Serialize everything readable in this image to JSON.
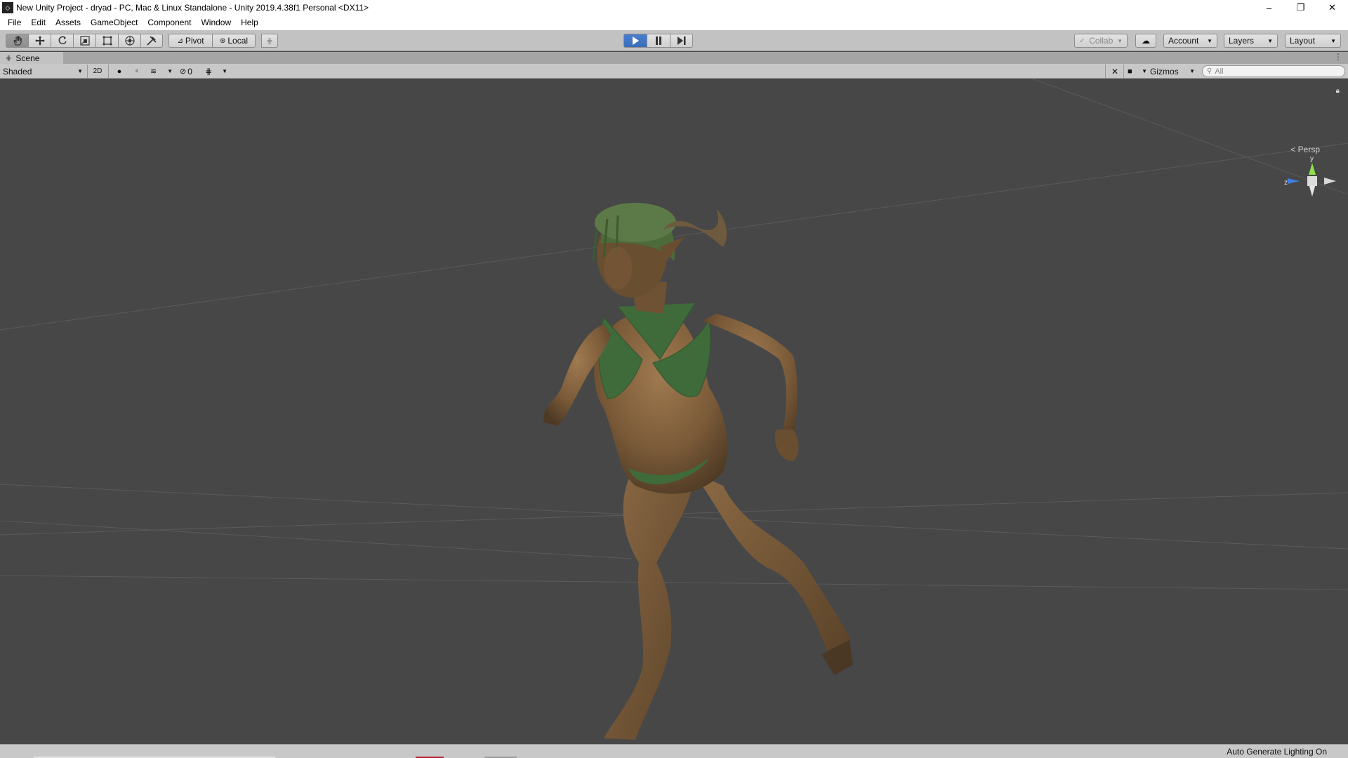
{
  "window": {
    "title": "New Unity Project - dryad - PC, Mac & Linux Standalone - Unity 2019.4.38f1 Personal <DX11>",
    "app_icon": "unity-logo-icon",
    "controls": [
      "minimize-icon",
      "restore-icon",
      "close-icon"
    ]
  },
  "menu": {
    "items": [
      "File",
      "Edit",
      "Assets",
      "GameObject",
      "Component",
      "Window",
      "Help"
    ]
  },
  "toolbar": {
    "tools": [
      "hand-tool-icon",
      "move-tool-icon",
      "rotate-tool-icon",
      "scale-tool-icon",
      "rect-tool-icon",
      "transform-tool-icon",
      "custom-tool-icon"
    ],
    "pivot_label": "Pivot",
    "local_label": "Local",
    "playback": [
      "play-icon",
      "pause-icon",
      "step-icon"
    ],
    "collab_label": "Collab",
    "account_label": "Account",
    "layers_label": "Layers",
    "layout_label": "Layout"
  },
  "scene_tab": {
    "label": "Scene"
  },
  "scene_toolbar": {
    "draw_mode": "Shaded",
    "two_d_label": "2D",
    "hidden_count": "0",
    "gizmos_label": "Gizmos",
    "search_placeholder": "All"
  },
  "viewport": {
    "projection_label": "Persp",
    "axis_labels": {
      "y": "y",
      "z": "z"
    },
    "accent_colors": {
      "y_axis": "#8ee04a",
      "z_axis": "#3f7fe0",
      "x_axis": "#e0e0e0"
    }
  },
  "status": {
    "text": "Auto Generate Lighting On"
  }
}
